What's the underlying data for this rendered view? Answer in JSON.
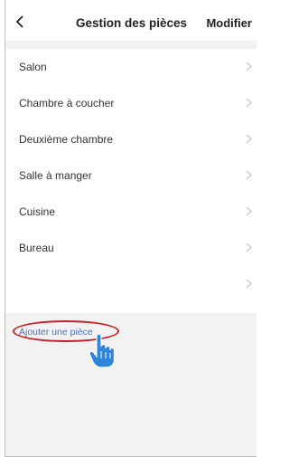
{
  "header": {
    "back_icon": "chevron-left-icon",
    "title": "Gestion des pièces",
    "edit_label": "Modifier"
  },
  "rooms": [
    {
      "label": "Salon"
    },
    {
      "label": "Chambre à coucher"
    },
    {
      "label": "Deuxième chambre"
    },
    {
      "label": "Salle à manger"
    },
    {
      "label": "Cuisine"
    },
    {
      "label": "Bureau"
    },
    {
      "label": ""
    }
  ],
  "add_room": {
    "label": "Ajouter une pièce",
    "highlight_color": "#c8202a",
    "pointer_icon": "hand-pointer-icon"
  },
  "colors": {
    "link": "#4a72c4",
    "background": "#f2f2f2",
    "pointer": "#2f86d8"
  }
}
